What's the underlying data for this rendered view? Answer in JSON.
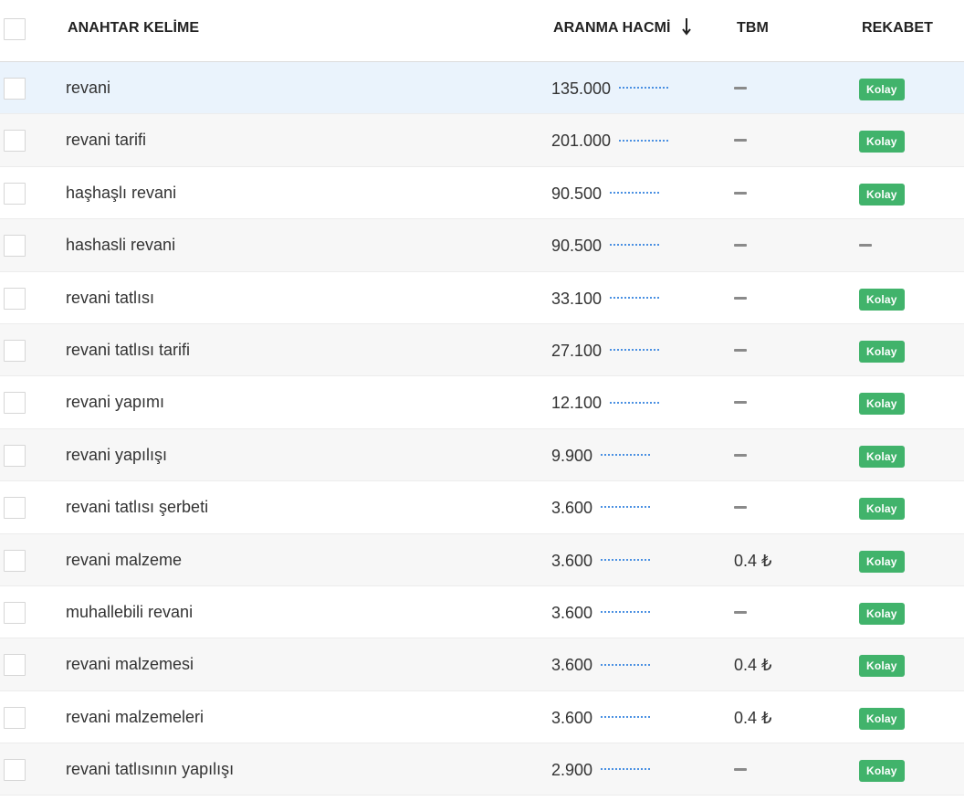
{
  "header": {
    "keyword": "ANAHTAR KELİME",
    "volume": "ARANMA HACMİ",
    "cpc": "TBM",
    "competition": "REKABET"
  },
  "rows": [
    {
      "keyword": "revani",
      "volume": "135.000",
      "cpc": "",
      "competition": "Kolay"
    },
    {
      "keyword": "revani tarifi",
      "volume": "201.000",
      "cpc": "",
      "competition": "Kolay"
    },
    {
      "keyword": "haşhaşlı revani",
      "volume": "90.500",
      "cpc": "",
      "competition": "Kolay"
    },
    {
      "keyword": "hashasli revani",
      "volume": "90.500",
      "cpc": "",
      "competition": ""
    },
    {
      "keyword": "revani tatlısı",
      "volume": "33.100",
      "cpc": "",
      "competition": "Kolay"
    },
    {
      "keyword": "revani tatlısı tarifi",
      "volume": "27.100",
      "cpc": "",
      "competition": "Kolay"
    },
    {
      "keyword": "revani yapımı",
      "volume": "12.100",
      "cpc": "",
      "competition": "Kolay"
    },
    {
      "keyword": "revani yapılışı",
      "volume": "9.900",
      "cpc": "",
      "competition": "Kolay"
    },
    {
      "keyword": "revani tatlısı şerbeti",
      "volume": "3.600",
      "cpc": "",
      "competition": "Kolay"
    },
    {
      "keyword": "revani malzeme",
      "volume": "3.600",
      "cpc": "0.4 ₺",
      "competition": "Kolay"
    },
    {
      "keyword": "muhallebili revani",
      "volume": "3.600",
      "cpc": "",
      "competition": "Kolay"
    },
    {
      "keyword": "revani malzemesi",
      "volume": "3.600",
      "cpc": "0.4 ₺",
      "competition": "Kolay"
    },
    {
      "keyword": "revani malzemeleri",
      "volume": "3.600",
      "cpc": "0.4 ₺",
      "competition": "Kolay"
    },
    {
      "keyword": "revani tatlısının yapılışı",
      "volume": "2.900",
      "cpc": "",
      "competition": "Kolay"
    }
  ],
  "icons": {
    "sort": "sort-down-arrow-icon",
    "trend": "trend-sparkline-icon"
  },
  "colors": {
    "badge_easy": "#41b36b",
    "row_highlight": "#eaf3fc",
    "trend_line": "#4a90e2"
  }
}
